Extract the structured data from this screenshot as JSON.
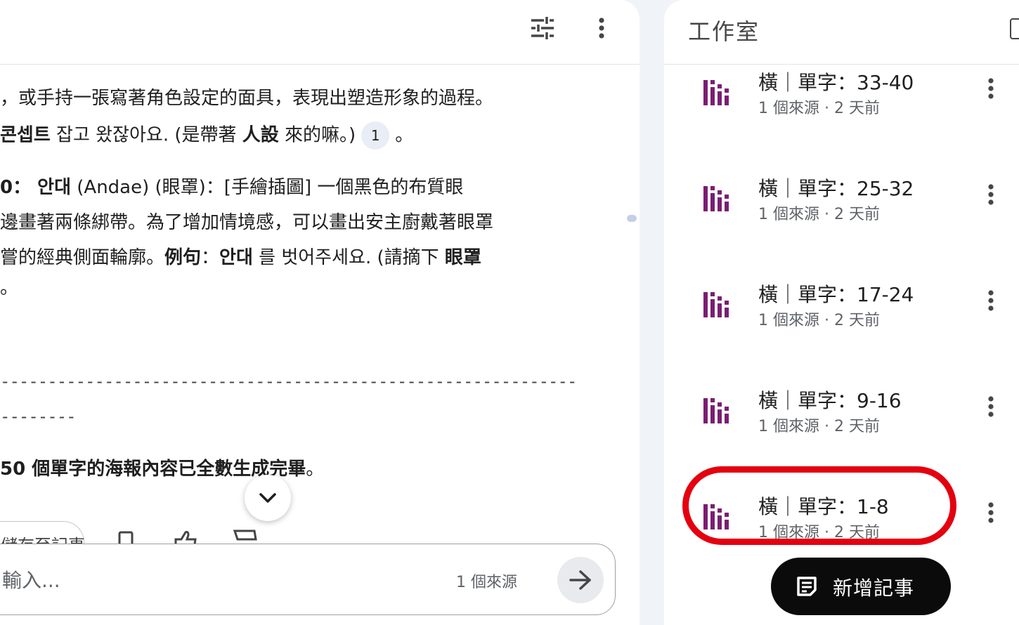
{
  "chat": {
    "lines": [
      {
        "segments": [
          {
            "t": "，或手持一張寫著角色設定的面具，表現出塑造形象的過程。",
            "b": false
          }
        ]
      },
      {
        "segments": [
          {
            "t": "콘셉트",
            "b": true
          },
          {
            "t": " 잡고 왔잖아요. (是帶著 ",
            "b": false
          },
          {
            "t": "人設",
            "b": true
          },
          {
            "t": " 來的嘛。)",
            "b": false
          }
        ],
        "citation": "1",
        "tail": "。"
      },
      {
        "segments": [
          {
            "t": "0： ",
            "b": true
          },
          {
            "t": "안대",
            "b": true
          },
          {
            "t": " (Andae) (眼罩)：[手繪插圖] 一個黑色的布質眼",
            "b": false
          }
        ]
      },
      {
        "segments": [
          {
            "t": "邊畫著兩條綁帶。為了增加情境感，可以畫出安主廚戴著眼罩",
            "b": false
          }
        ]
      },
      {
        "segments": [
          {
            "t": "嘗的經典側面輪廓。",
            "b": false
          },
          {
            "t": "例句",
            "b": true
          },
          {
            "t": "：",
            "b": false
          },
          {
            "t": "안대",
            "b": true
          },
          {
            "t": " 를 벗어주세요. (請摘下 ",
            "b": false
          },
          {
            "t": "眼罩",
            "b": true
          }
        ]
      },
      {
        "segments": [
          {
            "t": "。",
            "b": false
          }
        ]
      }
    ],
    "divider_long": "-------------------------------------------------------------",
    "divider_short": "--------",
    "summary_line": [
      {
        "t": "50 個單字的海報內容已全數生成完畢",
        "b": true
      },
      {
        "t": "。",
        "b": false
      }
    ],
    "save_note_label": "儲存至記事",
    "input_placeholder": "輸入...",
    "source_count": "1 個來源"
  },
  "studio": {
    "title": "工作室",
    "notes": [
      {
        "title": "橫｜單字：33-40",
        "meta": "1 個來源 · 2 天前"
      },
      {
        "title": "橫｜單字：25-32",
        "meta": "1 個來源 · 2 天前"
      },
      {
        "title": "橫｜單字：17-24",
        "meta": "1 個來源 · 2 天前"
      },
      {
        "title": "橫｜單字：9-16",
        "meta": "1 個來源 · 2 天前"
      },
      {
        "title": "橫｜單字：1-8",
        "meta": "1 個來源 · 2 天前",
        "highlighted": true
      }
    ],
    "add_note_label": "新增記事"
  },
  "colors": {
    "note_icon": "#7b1d73",
    "highlight": "#e4000f",
    "page_bg": "#f0f4f9"
  },
  "icons": {
    "settings": "tune-icon",
    "more": "more-vert-icon",
    "note": "audio-bars-icon",
    "send": "arrow-right-icon",
    "scroll": "chevron-down-icon",
    "add_note": "note-add-icon"
  }
}
